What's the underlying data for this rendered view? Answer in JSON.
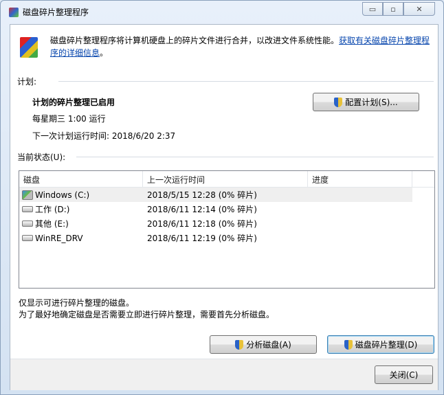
{
  "window": {
    "title": "磁盘碎片整理程序",
    "minimize": "▭",
    "maximize": "▫",
    "close": "✕"
  },
  "intro": {
    "text": "磁盘碎片整理程序将计算机硬盘上的碎片文件进行合并，以改进文件系统性能。",
    "link": "获取有关磁盘碎片整理程序的详细信息",
    "suffix": "。"
  },
  "schedule": {
    "heading": "计划:",
    "status": "计划的碎片整理已启用",
    "frequency": "每星期三  1:00 运行",
    "next_run": "下一次计划运行时间: 2018/6/20 2:37",
    "configure_button": "配置计划(S)..."
  },
  "current": {
    "heading": "当前状态(U):",
    "columns": [
      "磁盘",
      "上一次运行时间",
      "进度"
    ],
    "rows": [
      {
        "disk": "Windows (C:)",
        "last_run": "2018/5/15 12:28 (0% 碎片)",
        "progress": "",
        "icon": "windows-drive-icon"
      },
      {
        "disk": "工作 (D:)",
        "last_run": "2018/6/11 12:14 (0% 碎片)",
        "progress": "",
        "icon": "drive-icon"
      },
      {
        "disk": "其他 (E:)",
        "last_run": "2018/6/11 12:18 (0% 碎片)",
        "progress": "",
        "icon": "drive-icon"
      },
      {
        "disk": "WinRE_DRV",
        "last_run": "2018/6/11 12:19 (0% 碎片)",
        "progress": "",
        "icon": "drive-icon"
      }
    ]
  },
  "notes": [
    "仅显示可进行碎片整理的磁盘。",
    "为了最好地确定磁盘是否需要立即进行碎片整理，需要首先分析磁盘。"
  ],
  "buttons": {
    "analyze": "分析磁盘(A)",
    "defrag": "磁盘碎片整理(D)",
    "close": "关闭(C)"
  }
}
